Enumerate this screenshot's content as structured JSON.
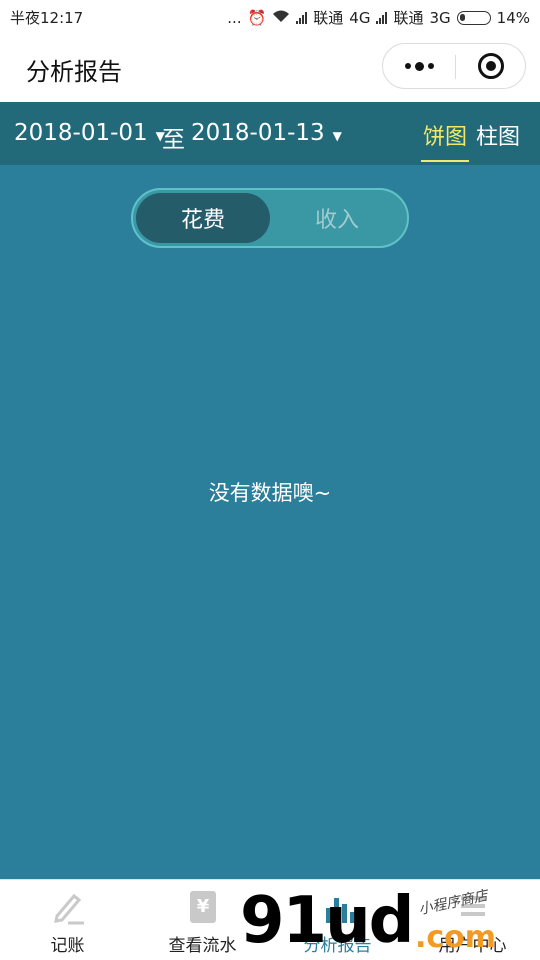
{
  "status_bar": {
    "time": "半夜12:17",
    "dots": "...",
    "carrier1": "联通",
    "network1": "4G",
    "carrier2": "联通",
    "network2": "3G",
    "battery": "14%"
  },
  "title_bar": {
    "title": "分析报告"
  },
  "filter": {
    "start_date": "2018-01-01",
    "separator": "至",
    "end_date": "2018-01-13",
    "tabs": [
      {
        "label": "饼图",
        "active": true
      },
      {
        "label": "柱图",
        "active": false
      }
    ]
  },
  "toggle": {
    "expense": "花费",
    "income": "收入",
    "selected": "花费"
  },
  "main": {
    "empty_message": "没有数据噢~"
  },
  "tabbar": {
    "items": [
      {
        "label": "记账",
        "icon": "pencil-icon"
      },
      {
        "label": "查看流水",
        "icon": "receipt-icon"
      },
      {
        "label": "分析报告",
        "icon": "chart-icon",
        "active": true
      },
      {
        "label": "用户中心",
        "icon": "user-icon"
      }
    ]
  },
  "watermark": {
    "brand": "91ud",
    "domain": ".com",
    "handwriting": "小程序商店"
  },
  "colors": {
    "header": "#226a79",
    "content": "#2b7f9a",
    "accent_yellow": "#f0e96b",
    "toggle_active": "#245c6a"
  }
}
